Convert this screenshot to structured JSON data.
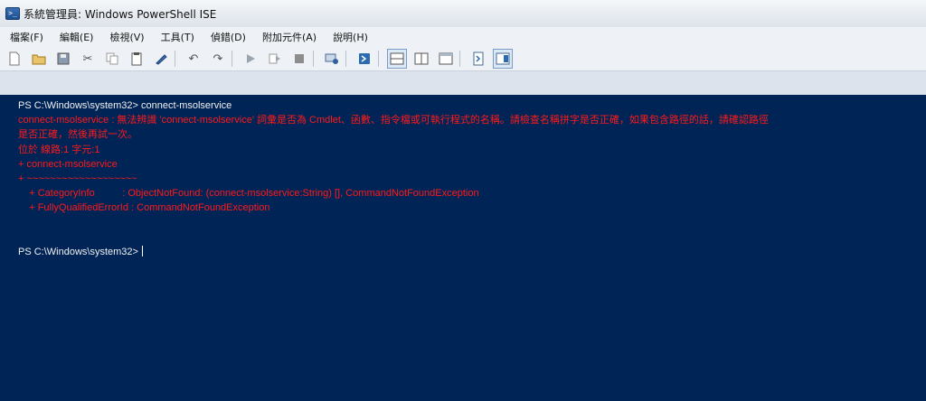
{
  "window": {
    "title": "系統管理員: Windows PowerShell ISE",
    "icon": "powershell-icon"
  },
  "menu": [
    {
      "label": "檔案(F)"
    },
    {
      "label": "編輯(E)"
    },
    {
      "label": "檢視(V)"
    },
    {
      "label": "工具(T)"
    },
    {
      "label": "偵錯(D)"
    },
    {
      "label": "附加元件(A)"
    },
    {
      "label": "說明(H)"
    }
  ],
  "toolbar": {
    "icons": [
      "new-file-icon",
      "open-folder-icon",
      "save-icon",
      "cut-icon",
      "copy-icon",
      "paste-icon",
      "clear-icon",
      "undo-icon",
      "redo-icon",
      "run-icon",
      "run-selection-icon",
      "stop-icon",
      "remote-session-icon",
      "powershell-prompt-icon",
      "layout-top-icon",
      "layout-right-icon",
      "layout-max-icon",
      "show-script-icon",
      "show-console-icon"
    ]
  },
  "console": {
    "lines": [
      {
        "text": "PS C:\\Windows\\system32> connect-msolservice",
        "kind": "prompt"
      },
      {
        "text": "connect-msolservice : 無法辨識 'connect-msolservice' 詞彙是否為 Cmdlet、函數、指令檔或可執行程式的名稱。請檢查名稱拼字是否正確，如果包含路徑的話，請確認路徑",
        "kind": "error"
      },
      {
        "text": "是否正確，然後再試一次。",
        "kind": "error"
      },
      {
        "text": "位於 線路:1 字元:1",
        "kind": "error"
      },
      {
        "text": "+ connect-msolservice",
        "kind": "error"
      },
      {
        "text": "+ ~~~~~~~~~~~~~~~~~~~",
        "kind": "error"
      },
      {
        "text": "    + CategoryInfo          : ObjectNotFound: (connect-msolservice:String) [], CommandNotFoundException",
        "kind": "error"
      },
      {
        "text": "    + FullyQualifiedErrorId : CommandNotFoundException",
        "kind": "error"
      },
      {
        "text": "",
        "kind": "blank"
      },
      {
        "text": "",
        "kind": "blank"
      },
      {
        "text": "PS C:\\Windows\\system32> ",
        "kind": "prompt"
      }
    ],
    "colors": {
      "background": "#012456",
      "error": "#ff1a1a",
      "text": "#f1f1f1"
    }
  }
}
